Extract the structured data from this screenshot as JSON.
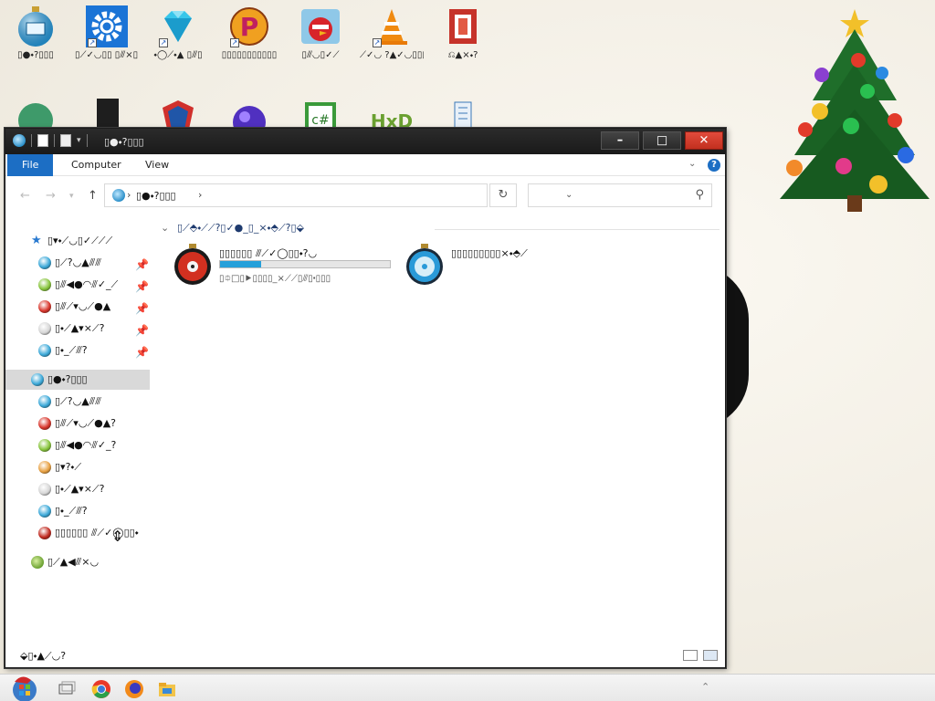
{
  "desktop": {
    "icons": [
      {
        "label": "▯●⬩?▯▯▯",
        "icon": "monitor-bauble-icon"
      },
      {
        "label": "▯⟋✓◡▯▯ ▯⫻×▯▯▯",
        "icon": "gear-settings-icon"
      },
      {
        "label": "⬩◯⟋⬩▲ ▯⫻▯",
        "icon": "diamond-icon"
      },
      {
        "label": "▯▯▯▯▯▯▯▯▯▯▯",
        "icon": "p-logo-icon"
      },
      {
        "label": "▯⫻◡▯✓⟋",
        "icon": "angry-bird-icon"
      },
      {
        "label": "⟋✓◡ ?▲✓◡▯▯▯",
        "icon": "vlc-cone-icon"
      },
      {
        "label": "⎌▲×⬩?",
        "icon": "office-icon"
      }
    ]
  },
  "window": {
    "title": "▯●⬩?▯▯▯",
    "ribbon_tabs": [
      "File",
      "Computer",
      "View"
    ],
    "address_path": "▯●⬩?▯▯▯",
    "search_placeholder": "",
    "group_header": "▯⟋⬘⬩⟋⟋?▯✓●_▯_×⬩⬘⟋?▯⬙",
    "drives": [
      {
        "name": "▯▯▯▯▯▯ ⫻⟋✓◯▯▯⬩?◡",
        "free": "▯⯐□▯⯈▯▯▯▯_×⟋⟋▯⫻▯⬝▯▯▯",
        "usage": 0.24,
        "icon": "hard-drive-bauble-red-icon"
      },
      {
        "name": "▯▯▯▯▯▯▯▯▯×⬩⬘⟋",
        "free": "",
        "usage": null,
        "icon": "dvd-drive-bauble-icon"
      }
    ],
    "status": "⬙▯⬩▲⟋◡?"
  },
  "nav_pane": {
    "quick_access_label": "▯▾⬩⟋◡▯✓⟋⟋⟋",
    "quick_items": [
      {
        "label": "▯⟋?◡▲⫻⫻",
        "color": "#3aa8d8"
      },
      {
        "label": "▯⫻◀●◠⫻✓_⟋",
        "color": "#86c43a"
      },
      {
        "label": "▯⫻⟋▾◡⟋●▲",
        "color": "#d8342a"
      },
      {
        "label": "▯⬩⟋▲▾×⟋?",
        "color": "#d6d6d6"
      },
      {
        "label": "▯⬩_⟋⫻?",
        "color": "#3aa8d8"
      }
    ],
    "this_pc_label": "▯●⬩?▯▯▯",
    "pc_items": [
      {
        "label": "▯⟋?◡▲⫻⫻",
        "color": "#3aa8d8"
      },
      {
        "label": "▯⫻⟋▾◡⟋●▲?",
        "color": "#d8342a"
      },
      {
        "label": "▯⫻◀●◠⫻✓_?",
        "color": "#86c43a"
      },
      {
        "label": "▯▾?⬩⟋",
        "color": "#e8a040"
      },
      {
        "label": "▯⬩⟋▲▾×⟋?",
        "color": "#d6d6d6"
      },
      {
        "label": "▯⬩_⟋⫻?",
        "color": "#3aa8d8"
      },
      {
        "label": "▯▯▯▯▯▯ ⫻⟋✓◯▯▯⬩",
        "color": "#c0281e"
      }
    ],
    "network_label": "▯⟋▲◀⫻×◡"
  },
  "taskbar": {
    "items": [
      "start-orb-icon",
      "task-view-icon",
      "chrome-icon",
      "firefox-icon",
      "file-explorer-icon"
    ]
  }
}
